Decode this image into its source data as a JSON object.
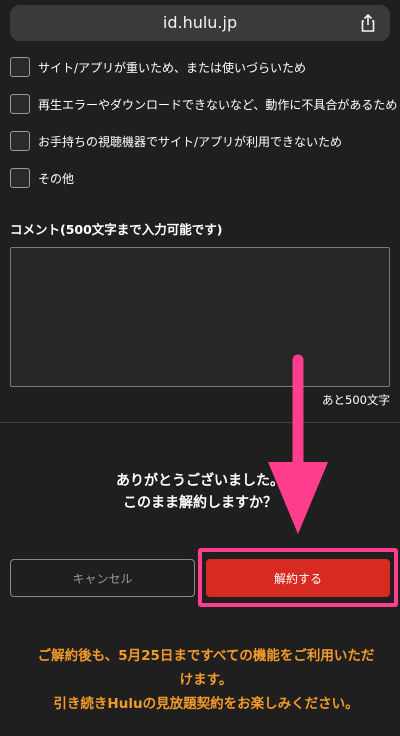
{
  "browser": {
    "url": "id.hulu.jp"
  },
  "options": [
    {
      "label": "サイト/アプリが重いため、または使いづらいため"
    },
    {
      "label": "再生エラーやダウンロードできないなど、動作に不具合があるため"
    },
    {
      "label": "お手持ちの視聴機器でサイト/アプリが利用できないため"
    },
    {
      "label": "その他"
    }
  ],
  "comment": {
    "label": "コメント(500文字まで入力可能です)",
    "counter": "あと500文字"
  },
  "confirm": {
    "line1": "ありがとうございました。",
    "line2": "このまま解約しますか？"
  },
  "buttons": {
    "cancel": "キャンセル",
    "cancel_membership": "解約する"
  },
  "notice": {
    "line1": "ご解約後も、5月25日まですべての機能をご利用いただ",
    "line2": "けます。",
    "line3": "引き続きHuluの見放題契約をお楽しみください。"
  },
  "colors": {
    "accent_red": "#d72a22",
    "highlight_pink": "#ff3e8e",
    "notice_orange": "#f39a2b"
  }
}
